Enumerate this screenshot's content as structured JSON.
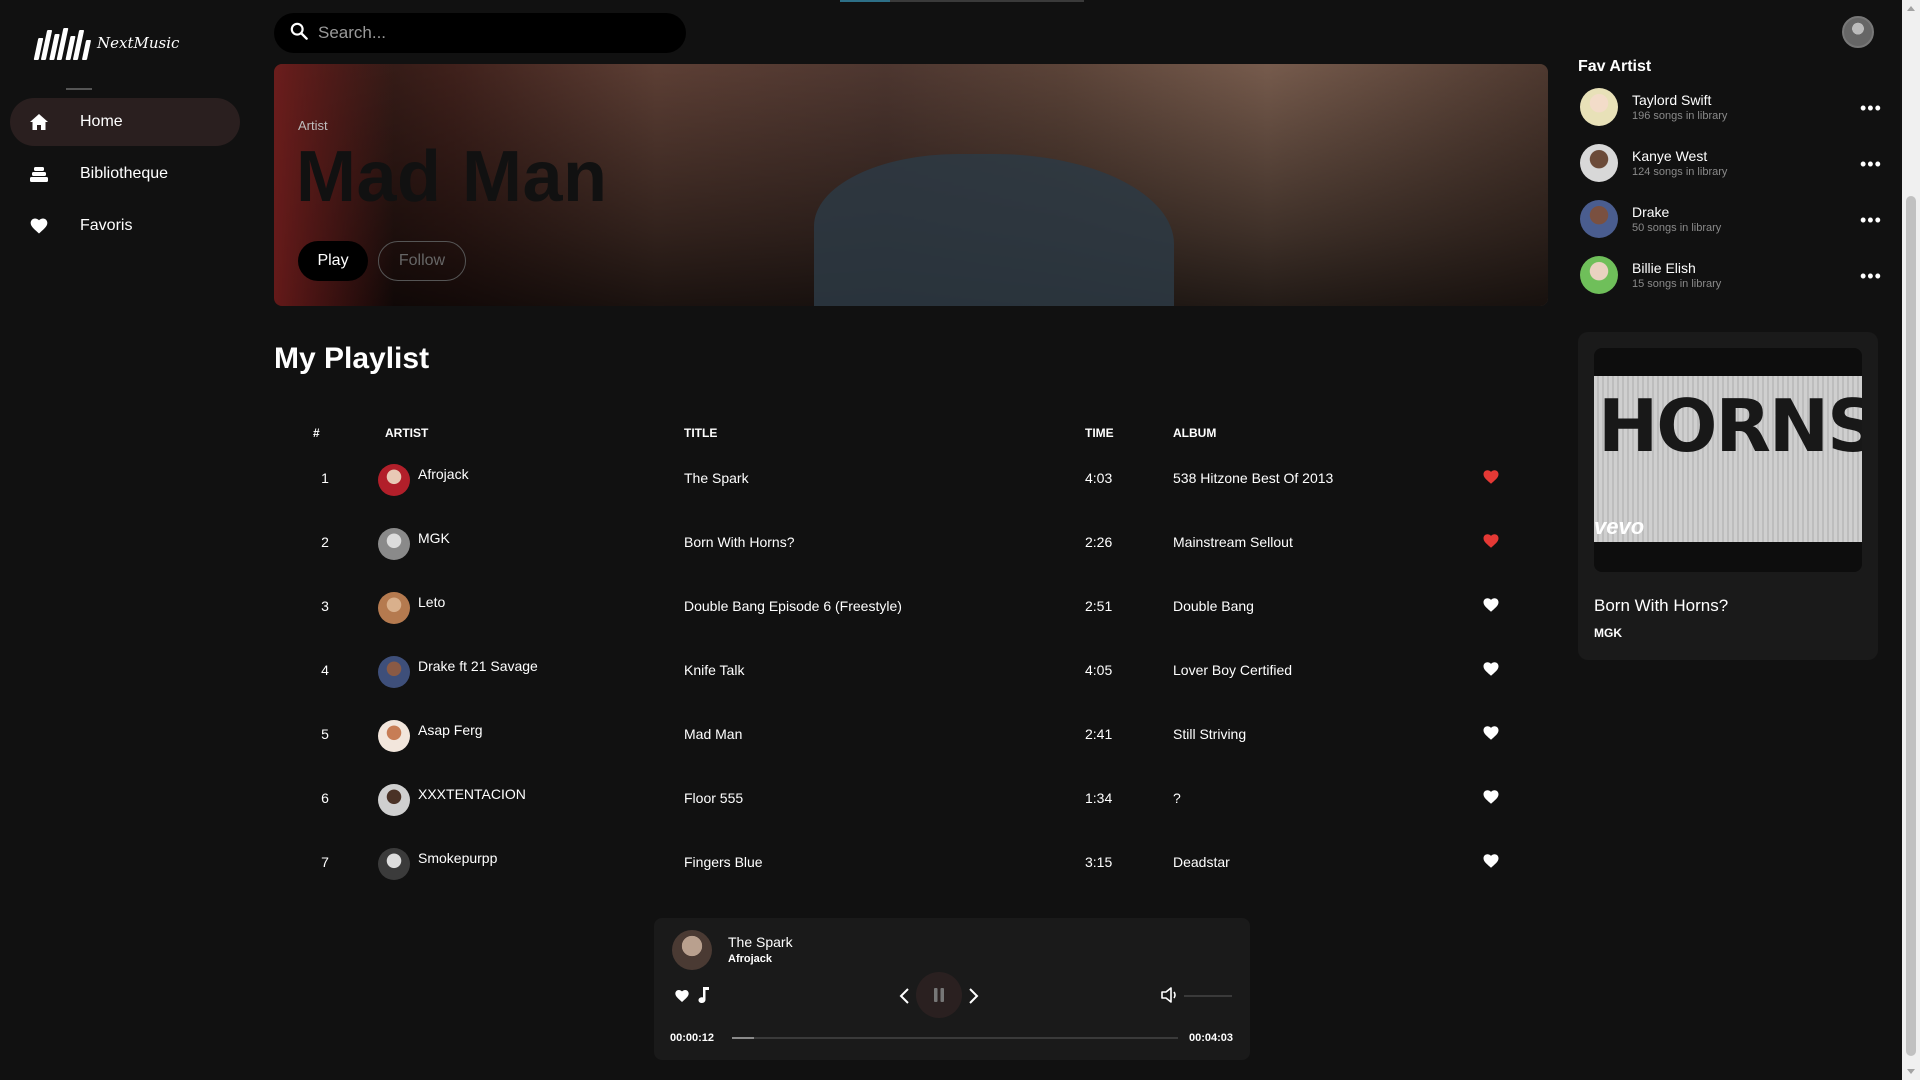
{
  "app": {
    "logo_text": "NextMusic"
  },
  "sidebar": {
    "items": [
      {
        "label": "Home",
        "icon": "home-icon",
        "active": true
      },
      {
        "label": "Bibliotheque",
        "icon": "library-icon",
        "active": false
      },
      {
        "label": "Favoris",
        "icon": "heart-icon",
        "active": false
      }
    ]
  },
  "search": {
    "placeholder": "Search..."
  },
  "hero": {
    "label": "Artist",
    "title": "Mad Man",
    "play_label": "Play",
    "follow_label": "Follow"
  },
  "playlist": {
    "title": "My Playlist",
    "columns": [
      "#",
      "ARTIST",
      "TITLE",
      "TIME",
      "ALBUM"
    ],
    "rows": [
      {
        "num": "1",
        "artist": "Afrojack",
        "title": "The Spark",
        "time": "4:03",
        "album": "538 Hitzone Best Of 2013",
        "liked": true
      },
      {
        "num": "2",
        "artist": "MGK",
        "title": "Born With Horns?",
        "time": "2:26",
        "album": "Mainstream Sellout",
        "liked": true
      },
      {
        "num": "3",
        "artist": "Leto",
        "title": "Double Bang Episode 6 (Freestyle)",
        "time": "2:51",
        "album": "Double Bang",
        "liked": false
      },
      {
        "num": "4",
        "artist": "Drake ft 21 Savage",
        "title": "Knife Talk",
        "time": "4:05",
        "album": "Lover Boy Certified",
        "liked": false
      },
      {
        "num": "5",
        "artist": "Asap Ferg",
        "title": "Mad Man",
        "time": "2:41",
        "album": "Still Striving",
        "liked": false
      },
      {
        "num": "6",
        "artist": "XXXTENTACION",
        "title": "Floor 555",
        "time": "1:34",
        "album": "?",
        "liked": false
      },
      {
        "num": "7",
        "artist": "Smokepurpp",
        "title": "Fingers Blue",
        "time": "3:15",
        "album": "Deadstar",
        "liked": false
      }
    ]
  },
  "fav_artists": {
    "title": "Fav Artist",
    "items": [
      {
        "name": "Taylord Swift",
        "sub": "196 songs in library"
      },
      {
        "name": "Kanye West",
        "sub": "124 songs in library"
      },
      {
        "name": "Drake",
        "sub": "50 songs in library"
      },
      {
        "name": "Billie Elish",
        "sub": "15 songs in library"
      }
    ]
  },
  "now_playing_card": {
    "title": "Born With Horns?",
    "artist": "MGK",
    "cover_text": "HORNS",
    "cover_badge": "vevo"
  },
  "player": {
    "title": "The Spark",
    "artist": "Afrojack",
    "current_time": "00:00:12",
    "total_time": "00:04:03",
    "progress": 0.05,
    "volume": 0.0
  },
  "colors": {
    "background": "#111111",
    "panel": "#1a1a1a",
    "accent_red": "#e53935",
    "active_nav": "#2a1f1f"
  }
}
